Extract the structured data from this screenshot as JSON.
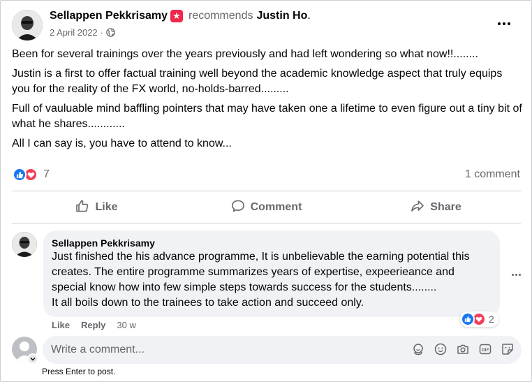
{
  "post": {
    "author": "Sellappen Pekkrisamy",
    "recommends_word": "recommends",
    "recommended": "Justin Ho",
    "recommended_suffix": ".",
    "date": "2 April 2022",
    "dot": "·",
    "privacy_icon": "globe-icon",
    "paragraphs": [
      "Been for several trainings over the years previously and had left wondering so what now!!........",
      "Justin is a first to offer factual training well beyond the academic knowledge aspect that truly equips you for the reality of the FX world, no-holds-barred.........",
      "Full of vauluable mind baffling pointers that may have taken one a lifetime to even figure out a tiny bit of what he shares............",
      "All I can say is, you have to attend to know..."
    ],
    "reaction_count": "7",
    "comment_count": "1 comment"
  },
  "actions": {
    "like": "Like",
    "comment": "Comment",
    "share": "Share"
  },
  "comment": {
    "author": "Sellappen Pekkrisamy",
    "lines": [
      "Just finished the his advance programme, It is unbelievable the earning potential this",
      "creates. The entire programme summarizes years of expertise, expeerieance and",
      "special know how into few simple steps towards success for the students........",
      "It all boils down to the trainees to take action and succeed only."
    ],
    "like": "Like",
    "reply": "Reply",
    "age": "30 w",
    "reaction_count": "2"
  },
  "composer": {
    "placeholder": "Write a comment...",
    "hint": "Press Enter to post."
  },
  "colors": {
    "like_blue": "#1877f2",
    "love_red": "#f33e58",
    "secondary_text": "#65676b",
    "bubble_bg": "#f0f2f5",
    "recommend_badge": "#f02849"
  }
}
